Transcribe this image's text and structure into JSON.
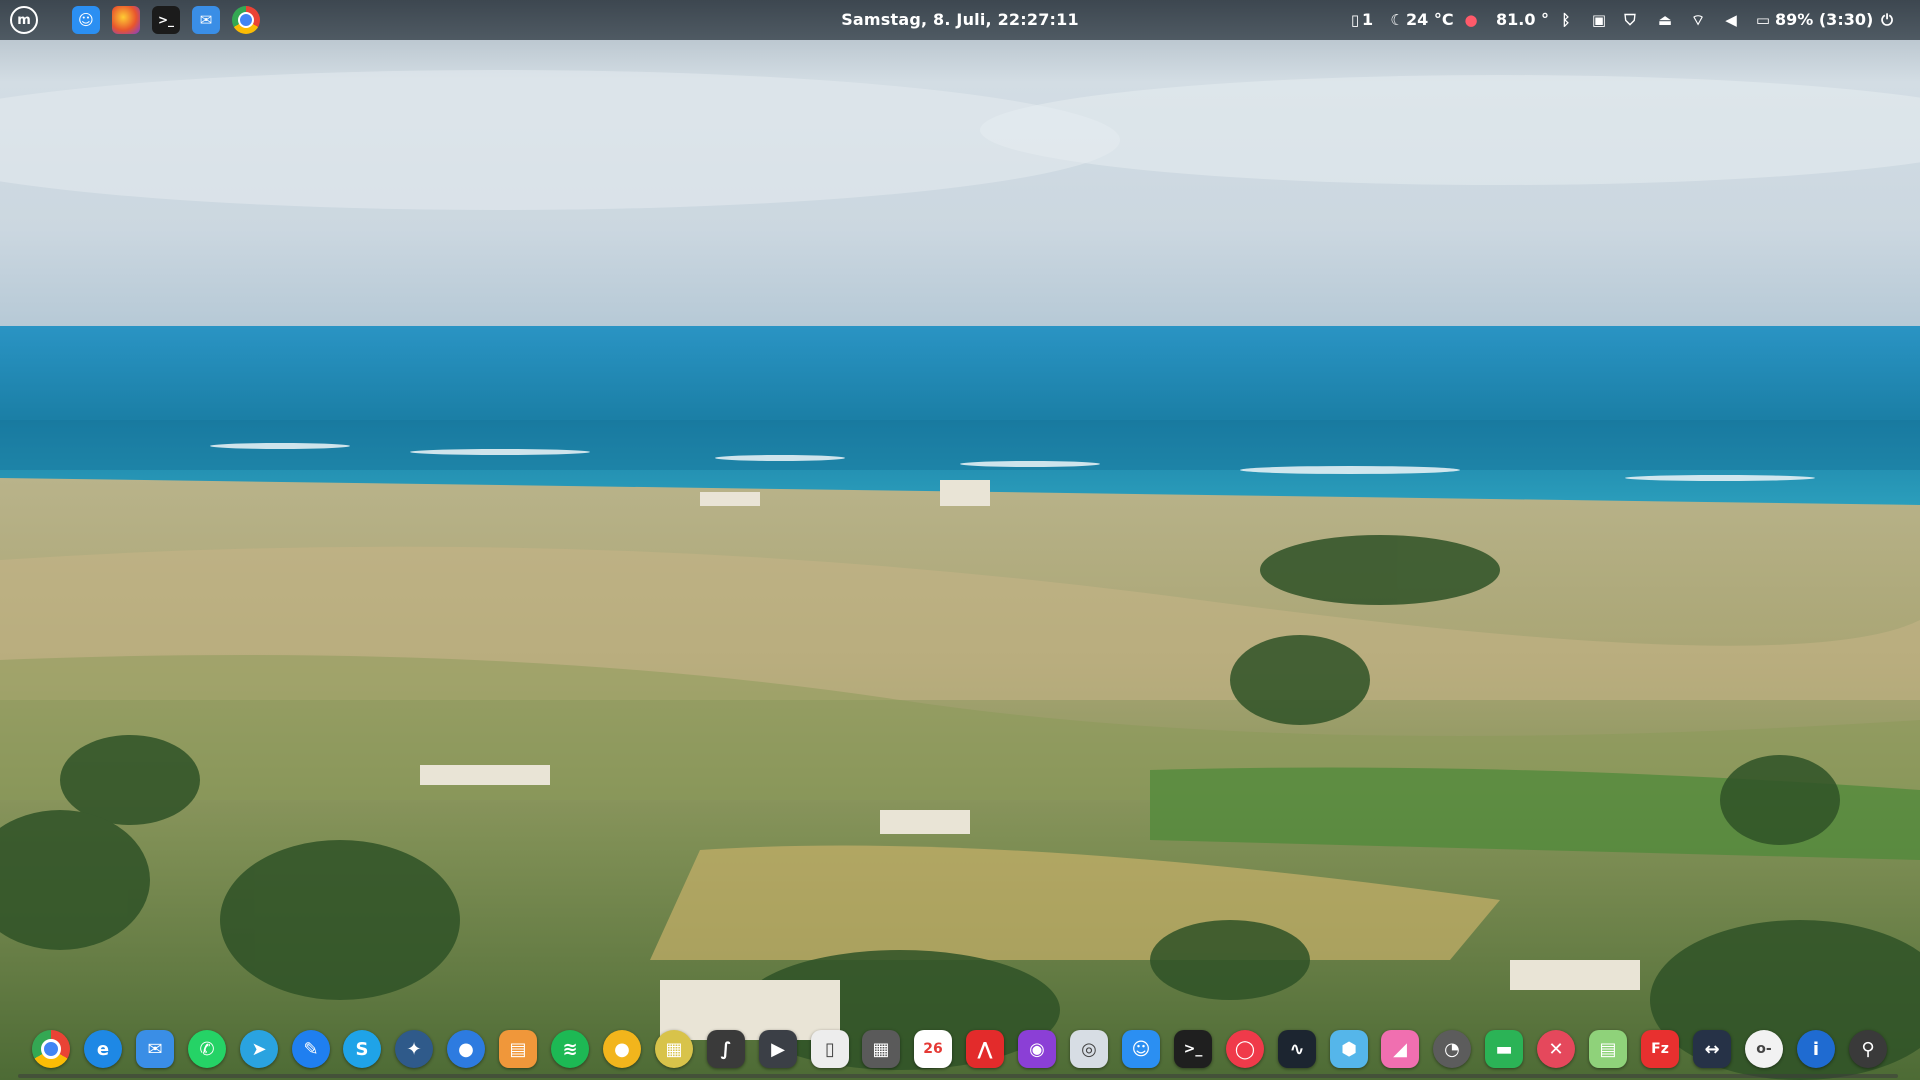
{
  "top_panel": {
    "menu_icon": "linux-mint-menu-icon",
    "launchers": [
      {
        "name": "finder-launcher",
        "icon": "finder-face-icon"
      },
      {
        "name": "firefox-launcher",
        "icon": "firefox-icon"
      },
      {
        "name": "terminal-launcher",
        "icon": "terminal-icon"
      },
      {
        "name": "mail-launcher",
        "icon": "mail-envelope-icon"
      },
      {
        "name": "chrome-launcher",
        "icon": "chrome-icon"
      }
    ],
    "clock": "Samstag,  8. Juli, 22:27:11",
    "tray": {
      "workspace": "1",
      "weather": "24 °C",
      "location_value": "81.0 °",
      "battery": "89% (3:30)"
    }
  },
  "dock": {
    "apps": [
      {
        "name": "chrome",
        "glyph": "",
        "bg": "#ffffff",
        "shape": "round"
      },
      {
        "name": "edge",
        "glyph": "e",
        "bg": "#1e88e5",
        "shape": "round"
      },
      {
        "name": "mail",
        "glyph": "✉",
        "bg": "#3a8ee6",
        "shape": "square"
      },
      {
        "name": "whatsapp",
        "glyph": "✆",
        "bg": "#25d366",
        "shape": "round"
      },
      {
        "name": "telegram",
        "glyph": "➤",
        "bg": "#2aa3e0",
        "shape": "round"
      },
      {
        "name": "messenger",
        "glyph": "✎",
        "bg": "#1f7ff0",
        "shape": "round"
      },
      {
        "name": "skype",
        "glyph": "S",
        "bg": "#1fa3e8",
        "shape": "round"
      },
      {
        "name": "feather",
        "glyph": "✦",
        "bg": "#2f5a8a",
        "shape": "round"
      },
      {
        "name": "chat-bubble",
        "glyph": "●",
        "bg": "#2d7be0",
        "shape": "round"
      },
      {
        "name": "archive",
        "glyph": "▤",
        "bg": "#f0973a",
        "shape": "square"
      },
      {
        "name": "spotify",
        "glyph": "≋",
        "bg": "#1db954",
        "shape": "round"
      },
      {
        "name": "duck",
        "glyph": "●",
        "bg": "#f2b51c",
        "shape": "round"
      },
      {
        "name": "notes",
        "glyph": "▦",
        "bg": "#d8c34a",
        "shape": "round"
      },
      {
        "name": "inkscape",
        "glyph": "∫",
        "bg": "#3a3a3a",
        "shape": "square"
      },
      {
        "name": "video-player",
        "glyph": "▶",
        "bg": "#3b3f46",
        "shape": "square"
      },
      {
        "name": "documents",
        "glyph": "▯",
        "bg": "#ededed",
        "shape": "square"
      },
      {
        "name": "calculator",
        "glyph": "▦",
        "bg": "#5a5a5a",
        "shape": "square"
      },
      {
        "name": "calendar",
        "glyph": "26",
        "bg": "#ffffff",
        "shape": "square"
      },
      {
        "name": "pdf-reader",
        "glyph": "⋀",
        "bg": "#e32b2b",
        "shape": "square"
      },
      {
        "name": "firefox",
        "glyph": "◉",
        "bg": "#8b3fd6",
        "shape": "square"
      },
      {
        "name": "screenshot",
        "glyph": "◎",
        "bg": "#d7dde4",
        "shape": "square"
      },
      {
        "name": "finder",
        "glyph": "☺",
        "bg": "#2b8ff2",
        "shape": "square"
      },
      {
        "name": "terminal",
        "glyph": ">_",
        "bg": "#1f1f1f",
        "shape": "square"
      },
      {
        "name": "ring-app",
        "glyph": "◯",
        "bg": "#f03a4a",
        "shape": "round"
      },
      {
        "name": "system-monitor",
        "glyph": "∿",
        "bg": "#1c2530",
        "shape": "square"
      },
      {
        "name": "hex-app",
        "glyph": "⬢",
        "bg": "#55b6ea",
        "shape": "square"
      },
      {
        "name": "pink-app",
        "glyph": "◢",
        "bg": "#f06fb0",
        "shape": "square"
      },
      {
        "name": "timeshift",
        "glyph": "◔",
        "bg": "#5c5c5c",
        "shape": "round"
      },
      {
        "name": "green-screen",
        "glyph": "▬",
        "bg": "#2bb356",
        "shape": "square"
      },
      {
        "name": "close-app",
        "glyph": "✕",
        "bg": "#e5485c",
        "shape": "round"
      },
      {
        "name": "spreadsheet",
        "glyph": "▤",
        "bg": "#8fd27a",
        "shape": "square"
      },
      {
        "name": "filezilla",
        "glyph": "Fz",
        "bg": "#e8302f",
        "shape": "square"
      },
      {
        "name": "remote-desktop",
        "glyph": "↔",
        "bg": "#263247",
        "shape": "square"
      },
      {
        "name": "key-app",
        "glyph": "o-",
        "bg": "#f2f2f2",
        "shape": "round"
      },
      {
        "name": "password-manager",
        "glyph": "i",
        "bg": "#1f6bd1",
        "shape": "round"
      },
      {
        "name": "lock-app",
        "glyph": "⚲",
        "bg": "#3a3a3a",
        "shape": "round"
      }
    ]
  },
  "colors": {
    "panel": "#434e57",
    "sky": "#c9d6e0",
    "sea": "#1e8fb0",
    "fields": "#b8a978"
  }
}
